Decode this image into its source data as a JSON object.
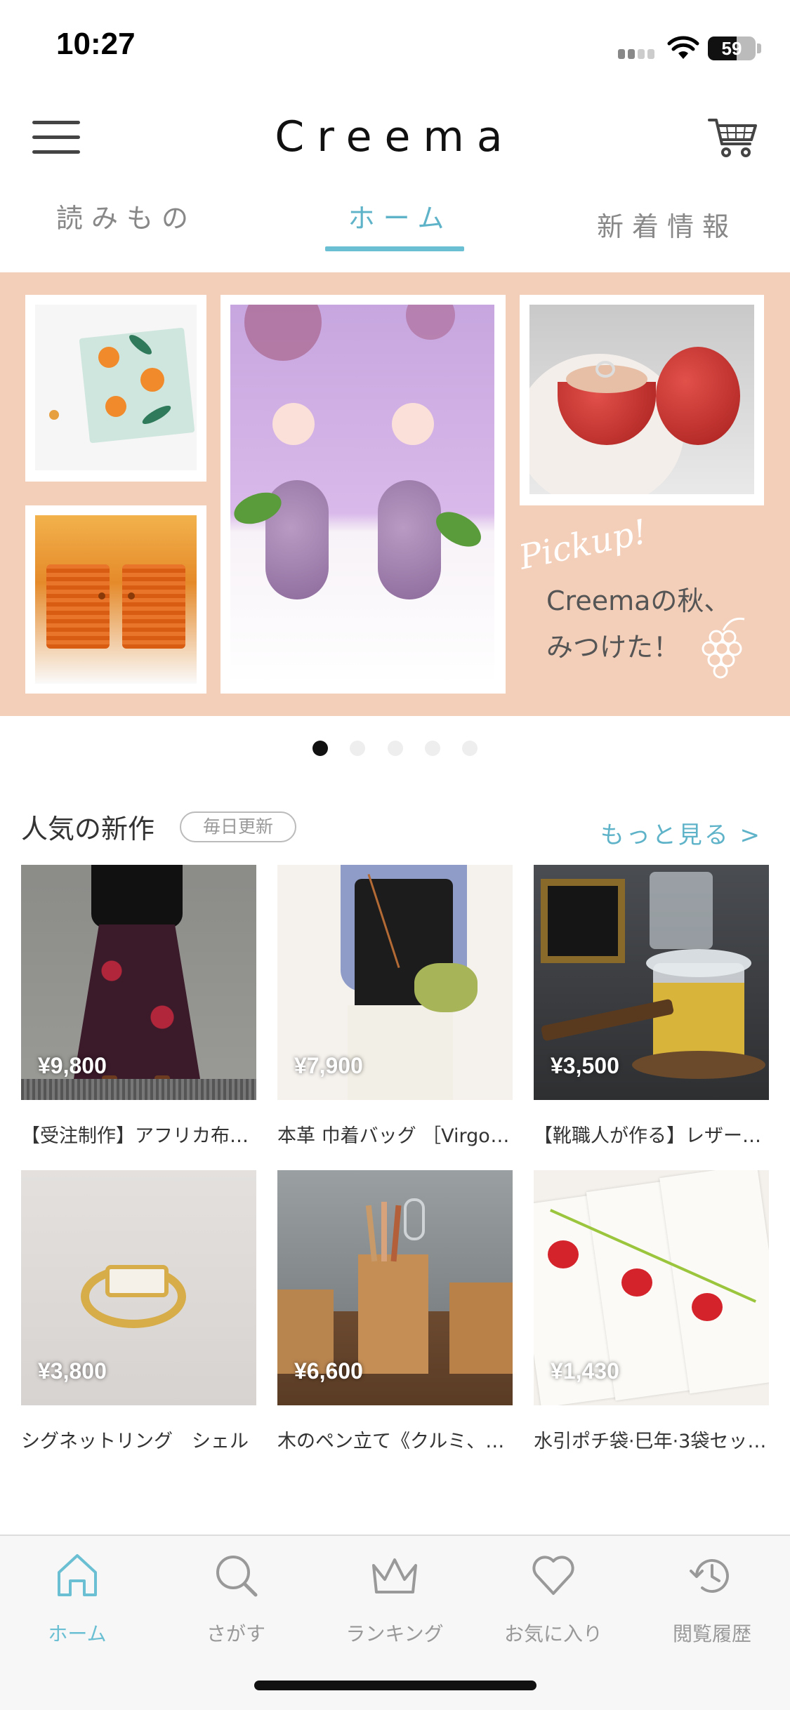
{
  "status_bar": {
    "time": "10:27",
    "battery": "59"
  },
  "header": {
    "logo": "Creema"
  },
  "tabs": [
    {
      "label": "読みもの",
      "active": false
    },
    {
      "label": "ホーム",
      "active": true
    },
    {
      "label": "新着情報",
      "active": false
    }
  ],
  "banner": {
    "script_text": "Pickup!",
    "caption_line1": "Creemaの秋、",
    "caption_line2": "みつけた！",
    "page_count": 5,
    "active_page": 1
  },
  "section": {
    "title": "人気の新作",
    "badge": "毎日更新",
    "more_label": "もっと見る >"
  },
  "products": [
    {
      "price": "¥9,800",
      "name": "【受注制作】アフリカ布のギ…"
    },
    {
      "price": "¥7,900",
      "name": "本革 巾着バッグ ［Virgo-…"
    },
    {
      "price": "¥3,500",
      "name": "【靴職人が作る】レザーコー…"
    },
    {
      "price": "¥3,800",
      "name": "シグネットリング　シェル"
    },
    {
      "price": "¥6,600",
      "name": "木のペン立て《クルミ、キ…"
    },
    {
      "price": "¥1,430",
      "name": "水引ポチ袋·巳年·3袋セッ…"
    }
  ],
  "bottom_nav": [
    {
      "label": "ホーム",
      "icon": "home-icon",
      "active": true
    },
    {
      "label": "さがす",
      "icon": "search-icon",
      "active": false
    },
    {
      "label": "ランキング",
      "icon": "crown-icon",
      "active": false
    },
    {
      "label": "お気に入り",
      "icon": "heart-icon",
      "active": false
    },
    {
      "label": "閲覧履歴",
      "icon": "history-icon",
      "active": false
    }
  ],
  "colors": {
    "accent": "#6bbfd3",
    "banner_bg": "#f3cfb9"
  }
}
